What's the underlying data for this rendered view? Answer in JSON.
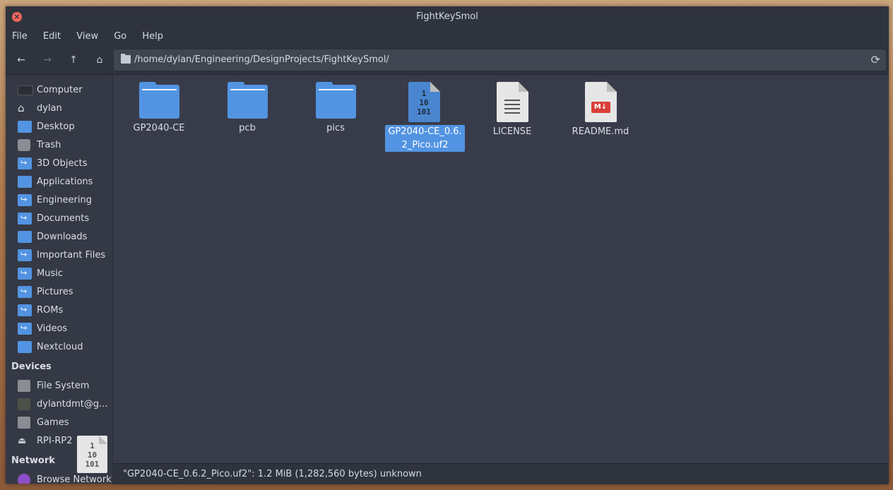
{
  "window": {
    "title": "FightKeySmol"
  },
  "menu": [
    "File",
    "Edit",
    "View",
    "Go",
    "Help"
  ],
  "toolbar": {
    "path": "/home/dylan/Engineering/DesignProjects/FightKeySmol/"
  },
  "sidebar": {
    "places": [
      {
        "label": "Computer",
        "icon": "computer-icon"
      },
      {
        "label": "dylan",
        "icon": "home-icon"
      },
      {
        "label": "Desktop",
        "icon": "desktop-folder-icon"
      },
      {
        "label": "Trash",
        "icon": "trash-icon"
      },
      {
        "label": "3D Objects",
        "icon": "folder-link-icon"
      },
      {
        "label": "Applications",
        "icon": "folder-icon"
      },
      {
        "label": "Engineering",
        "icon": "folder-link-icon"
      },
      {
        "label": "Documents",
        "icon": "folder-link-icon"
      },
      {
        "label": "Downloads",
        "icon": "downloads-folder-icon"
      },
      {
        "label": "Important Files",
        "icon": "folder-link-icon"
      },
      {
        "label": "Music",
        "icon": "folder-link-icon"
      },
      {
        "label": "Pictures",
        "icon": "folder-link-icon"
      },
      {
        "label": "ROMs",
        "icon": "folder-link-icon"
      },
      {
        "label": "Videos",
        "icon": "folder-link-icon"
      },
      {
        "label": "Nextcloud",
        "icon": "folder-icon"
      }
    ],
    "devices_header": "Devices",
    "devices": [
      {
        "label": "File System",
        "icon": "drive-icon"
      },
      {
        "label": "dylantdmt@g...",
        "icon": "network-drive-icon"
      },
      {
        "label": "Games",
        "icon": "drive-icon"
      },
      {
        "label": "RPI-RP2",
        "icon": "eject-icon"
      }
    ],
    "network_header": "Network",
    "network": [
      {
        "label": "Browse Network",
        "icon": "network-icon"
      }
    ]
  },
  "files": [
    {
      "label": "GP2040-CE",
      "type": "folder"
    },
    {
      "label": "pcb",
      "type": "folder"
    },
    {
      "label": "pics",
      "type": "folder"
    },
    {
      "label": "GP2040-CE_0.6.2_Pico.uf2",
      "type": "binary",
      "selected": true
    },
    {
      "label": "LICENSE",
      "type": "text"
    },
    {
      "label": "README.md",
      "type": "markdown"
    }
  ],
  "binary_glyph": [
    "1",
    "10",
    "101"
  ],
  "markdown_badge": "M↓",
  "status": "\"GP2040-CE_0.6.2_Pico.uf2\": 1.2 MiB (1,282,560 bytes) unknown"
}
